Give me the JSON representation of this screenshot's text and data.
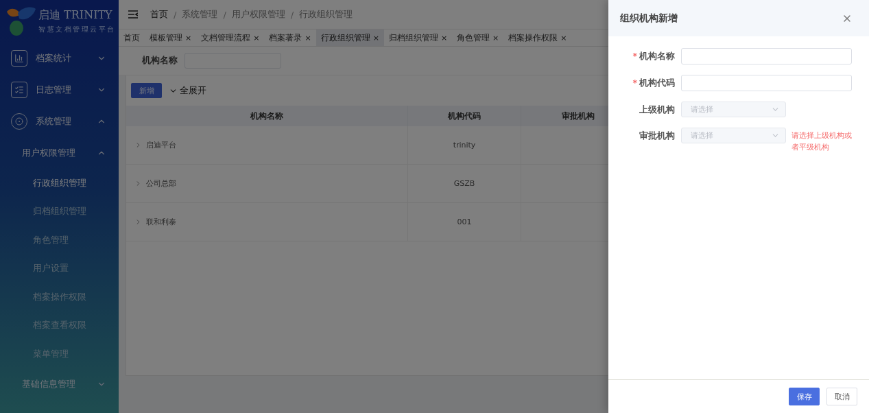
{
  "logo": {
    "name": "启迪 TRINITY",
    "tagline": "智慧文档管理云平台"
  },
  "sidebar": {
    "items": [
      {
        "label": "档案统计",
        "expanded": false
      },
      {
        "label": "日志管理",
        "expanded": false
      },
      {
        "label": "系统管理",
        "expanded": true,
        "children": [
          {
            "label": "用户权限管理",
            "expanded": true,
            "children": [
              {
                "label": "行政组织管理",
                "selected": true
              },
              {
                "label": "归档组织管理",
                "selected": false
              },
              {
                "label": "角色管理",
                "selected": false
              },
              {
                "label": "用户设置",
                "selected": false
              },
              {
                "label": "档案操作权限",
                "selected": false
              },
              {
                "label": "档案查看权限",
                "selected": false
              },
              {
                "label": "菜单管理",
                "selected": false
              }
            ]
          },
          {
            "label": "基础信息管理",
            "expanded": false
          }
        ]
      }
    ]
  },
  "breadcrumb": [
    "首页",
    "系统管理",
    "用户权限管理",
    "行政组织管理"
  ],
  "breadcrumb_separator": "/",
  "required_mark": "*",
  "tabs": [
    {
      "label": "首页",
      "closable": false,
      "selected": false
    },
    {
      "label": "模板管理",
      "closable": true,
      "selected": false
    },
    {
      "label": "文档管理流程",
      "closable": true,
      "selected": false
    },
    {
      "label": "档案著录",
      "closable": true,
      "selected": false
    },
    {
      "label": "行政组织管理",
      "closable": true,
      "selected": true
    },
    {
      "label": "归档组织管理",
      "closable": true,
      "selected": false
    },
    {
      "label": "角色管理",
      "closable": true,
      "selected": false
    },
    {
      "label": "档案操作权限",
      "closable": true,
      "selected": false
    }
  ],
  "tab_close": "×",
  "filter": {
    "label": "机构名称"
  },
  "toolbar": {
    "add": "新增",
    "expand_all": "全展开"
  },
  "table": {
    "columns": [
      "机构名称",
      "机构代码",
      "审批机构"
    ],
    "rows": [
      {
        "cells": [
          "启迪平台",
          "trinity"
        ],
        "expanded": false
      },
      {
        "cells": [
          "公司总部",
          "GSZB"
        ],
        "expanded": false
      },
      {
        "cells": [
          "联和利泰",
          "001"
        ],
        "expanded": false
      }
    ]
  },
  "drawer": {
    "title": "组织机构新增",
    "fields": [
      {
        "label": "机构名称",
        "kind": "input",
        "required": true
      },
      {
        "label": "机构代码",
        "kind": "input",
        "required": true
      },
      {
        "label": "上级机构",
        "kind": "select",
        "required": false,
        "disabled": true,
        "placeholder": "请选择"
      },
      {
        "label": "审批机构",
        "kind": "select",
        "required": false,
        "disabled": true,
        "placeholder": "请选择",
        "error": "请选择上级机构或者平级机构"
      }
    ],
    "buttons": [
      {
        "label": "保存",
        "kind": "primary"
      },
      {
        "label": "取消",
        "kind": "plain"
      }
    ]
  }
}
